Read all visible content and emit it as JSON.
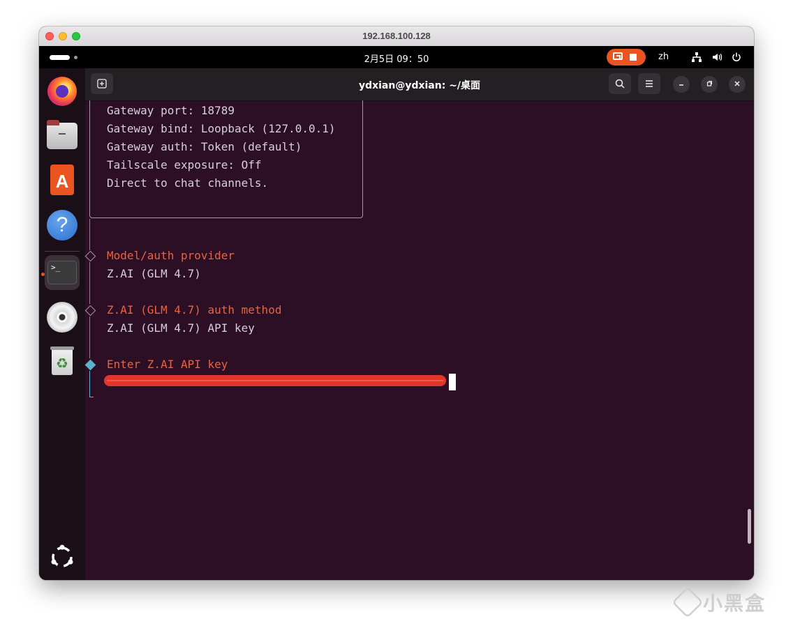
{
  "mac": {
    "title": "192.168.100.128"
  },
  "topbar": {
    "clock": "2月5日  09：50",
    "lang": "zh"
  },
  "terminal": {
    "title": "ydxian@ydxian: ~/桌面",
    "lines": {
      "gw_port": "Gateway port: 18789",
      "gw_bind": "Gateway bind: Loopback (127.0.0.1)",
      "gw_auth": "Gateway auth: Token (default)",
      "tailscale": "Tailscale exposure: Off",
      "direct": "Direct to chat channels.",
      "model_q": "Model/auth provider",
      "model_a": "Z.AI (GLM 4.7)",
      "auth_q": "Z.AI (GLM 4.7) auth method",
      "auth_a": "Z.AI (GLM 4.7) API key",
      "key_q": "Enter Z.AI API key"
    }
  },
  "watermark": {
    "text": "小黑盒"
  },
  "colors": {
    "accent": "#e95420",
    "prompt_orange": "#e9633e",
    "active_cyan": "#5bb3c9",
    "terminal_bg": "#2c0f25"
  },
  "icons": [
    "firefox-icon",
    "files-icon",
    "app-center-icon",
    "help-icon",
    "terminal-icon",
    "disc-icon",
    "trash-icon",
    "show-apps-icon",
    "new-tab-icon",
    "search-icon",
    "hamburger-menu-icon",
    "minimize-icon",
    "restore-icon",
    "close-icon",
    "screen-share-icon",
    "stop-icon",
    "network-icon",
    "volume-icon",
    "power-icon"
  ]
}
